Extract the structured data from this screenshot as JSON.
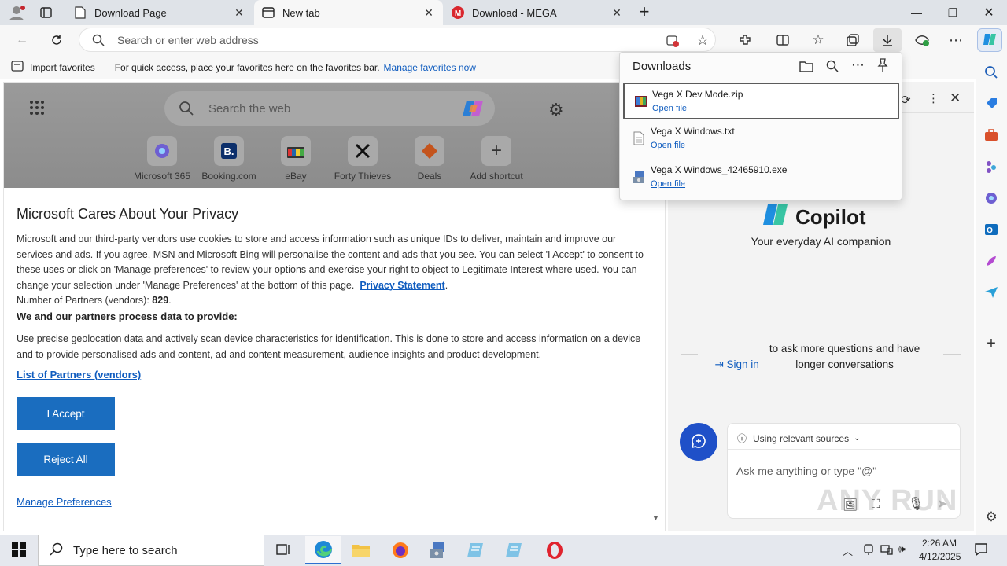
{
  "browser": {
    "tabs": [
      {
        "label": "Download Page",
        "active": false
      },
      {
        "label": "New tab",
        "active": true
      },
      {
        "label": "Download - MEGA",
        "active": false
      }
    ],
    "address_placeholder": "Search or enter web address",
    "favorites_bar": {
      "import_label": "Import favorites",
      "message": "For quick access, place your favorites here on the favorites bar.",
      "manage_link": "Manage favorites now"
    }
  },
  "ntp": {
    "search_placeholder": "Search the web",
    "shortcuts": [
      {
        "label": "Microsoft 365",
        "icon": "microsoft365-icon"
      },
      {
        "label": "Booking.com",
        "icon": "booking-icon"
      },
      {
        "label": "eBay",
        "icon": "ebay-icon"
      },
      {
        "label": "Forty Thieves",
        "icon": "forty-thieves-icon"
      },
      {
        "label": "Deals",
        "icon": "deals-icon"
      },
      {
        "label": "Add shortcut",
        "icon": "plus-icon"
      }
    ]
  },
  "privacy": {
    "title": "Microsoft Cares About Your Privacy",
    "body": "Microsoft and our third-party vendors use cookies to store and access information such as unique IDs to deliver, maintain and improve our services and ads. If you agree, MSN and Microsoft Bing will personalise the content and ads that you see. You can select 'I Accept' to consent to these uses or click on 'Manage preferences' to review your options and exercise your right to object to Legitimate Interest where used.  You can change your selection under 'Manage Preferences' at the bottom of this page.",
    "privacy_link": "Privacy Statement",
    "partners_label": "Number of Partners (vendors):",
    "partners_count": "829",
    "process_heading": "We and our partners process data to provide:",
    "process_body": "Use precise geolocation data and actively scan device characteristics for identification. This is done to store and access information on a device and to provide personalised ads and content, ad and content measurement, audience insights and product development.",
    "list_link": "List of Partners (vendors)",
    "accept_label": "I Accept",
    "reject_label": "Reject All",
    "manage_label": "Manage Preferences"
  },
  "downloads": {
    "title": "Downloads",
    "items": [
      {
        "name": "Vega X Dev Mode.zip",
        "action": "Open file",
        "icon": "zip-archive-icon"
      },
      {
        "name": "Vega X Windows.txt",
        "action": "Open file",
        "icon": "text-file-icon"
      },
      {
        "name": "Vega X Windows_42465910.exe",
        "action": "Open file",
        "icon": "installer-icon"
      }
    ]
  },
  "copilot": {
    "name": "Copilot",
    "tagline": "Your everyday AI companion",
    "signin_link": "Sign in",
    "signin_text": "to ask more questions and have longer conversations",
    "sources_label": "Using relevant sources",
    "input_placeholder": "Ask me anything or type \"@\""
  },
  "taskbar": {
    "search_placeholder": "Type here to search",
    "time": "2:26 AM",
    "date": "4/12/2025"
  },
  "watermark": "ANY RUN",
  "colors": {
    "accent": "#0f5cbf",
    "button_blue": "#1a6dbf",
    "copilot_blue": "#1f50c8"
  }
}
